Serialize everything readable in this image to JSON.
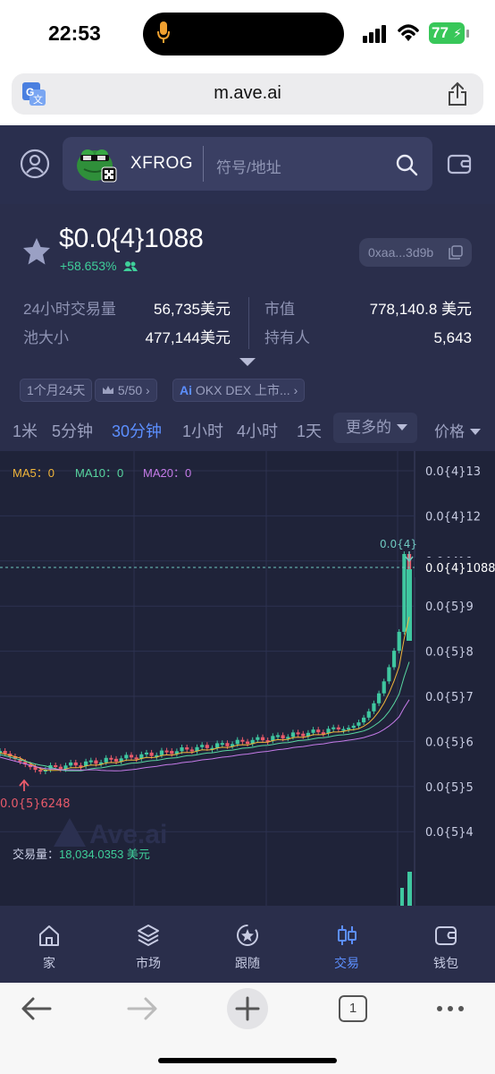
{
  "status_bar": {
    "time": "22:53",
    "battery": "77"
  },
  "browser": {
    "url": "m.ave.ai",
    "tab_count": "1"
  },
  "header": {
    "token_name": "XFROG",
    "search_placeholder": "符号/地址"
  },
  "token": {
    "price_prefix": "$0.0",
    "price_zeros": "{4}",
    "price_digits": "1088",
    "change": "+58.653%",
    "address": "0xaa...3d9b"
  },
  "stats": {
    "volume_label": "24小时交易量",
    "volume_value": "56,735美元",
    "pool_label": "池大小",
    "pool_value": "477,144美元",
    "mcap_label": "市值",
    "mcap_value": "778,140.8 美元",
    "holders_label": "持有人",
    "holders_value": "5,643"
  },
  "tags": {
    "age": "1个月24天",
    "rank": "5/50",
    "listing": "OKX DEX 上市..."
  },
  "timeframes": {
    "items": [
      "1米",
      "5分钟",
      "30分钟",
      "1小时",
      "4小时",
      "1天"
    ],
    "active": "30分钟",
    "more": "更多的",
    "price": "价格"
  },
  "chart_data": {
    "type": "candlestick",
    "indicators": {
      "ma5": "MA5：0",
      "ma10": "MA10：0",
      "ma20": "MA20：0"
    },
    "y_ticks": [
      "0.0{4}13",
      "0.0{4}12",
      "0.0{4}1",
      "0.0{5}9",
      "0.0{5}8",
      "0.0{5}7",
      "0.0{5}6",
      "0.0{5}5",
      "0.0{5}4"
    ],
    "current_price_label": "0.0{4}1088",
    "high_marker": "0.0{4}",
    "low_marker": "0.0{5}6248",
    "volume_label": "交易量：",
    "volume_value": "18,034.0353 美元",
    "watermark": "Ave.ai",
    "colors": {
      "up": "#3fc7a0",
      "down": "#e85a6a",
      "ma5": "#f2b63a",
      "ma10": "#58d6a0",
      "ma20": "#c57be8"
    }
  },
  "tabbar": {
    "home": "家",
    "market": "市场",
    "follow": "跟随",
    "trade": "交易",
    "wallet": "钱包"
  }
}
